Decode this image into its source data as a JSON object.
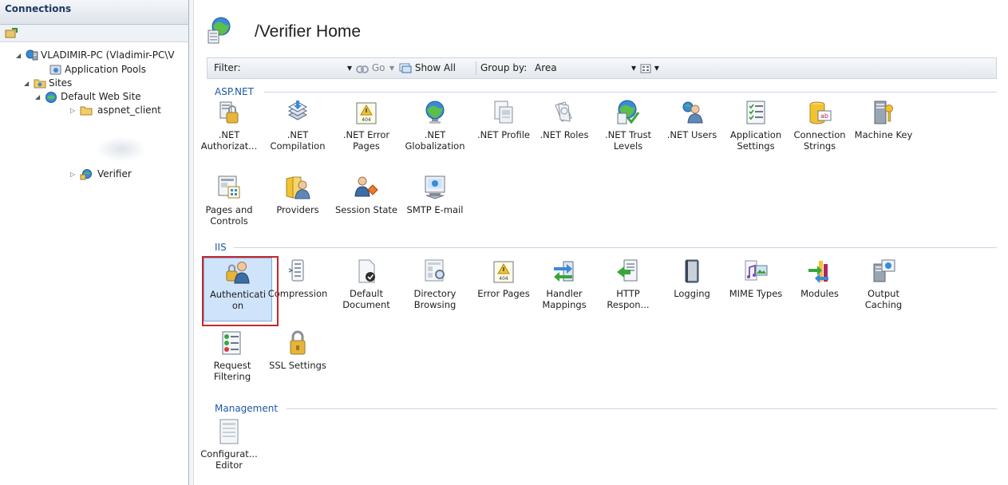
{
  "connections": {
    "header": "Connections",
    "tree": [
      {
        "label": "VLADIMIR-PC (Vladimir-PC\\V",
        "icon": "server-icon"
      },
      {
        "label": "Application Pools",
        "icon": "app-pools-icon"
      },
      {
        "label": "Sites",
        "icon": "sites-folder-icon"
      },
      {
        "label": "Default Web Site",
        "icon": "website-globe-icon"
      },
      {
        "label": "aspnet_client",
        "icon": "folder-icon"
      },
      {
        "label": "Verifier",
        "icon": "web-application-icon"
      }
    ]
  },
  "main": {
    "title": "/Verifier Home",
    "filter_bar": {
      "filter_label": "Filter:",
      "go_label": "Go",
      "show_all_label": "Show All",
      "group_by_label": "Group by:",
      "group_by_value": "Area"
    },
    "groups": [
      {
        "name": "ASP.NET",
        "features": [
          {
            "label": ".NET Authorizat...",
            "icon": "net-authorization-icon"
          },
          {
            "label": ".NET Compilation",
            "icon": "net-compilation-icon"
          },
          {
            "label": ".NET Error Pages",
            "icon": "net-error-pages-icon"
          },
          {
            "label": ".NET Globalization",
            "icon": "net-globalization-icon"
          },
          {
            "label": ".NET Profile",
            "icon": "net-profile-icon"
          },
          {
            "label": ".NET Roles",
            "icon": "net-roles-icon"
          },
          {
            "label": ".NET Trust Levels",
            "icon": "net-trust-levels-icon"
          },
          {
            "label": ".NET Users",
            "icon": "net-users-icon"
          },
          {
            "label": "Application Settings",
            "icon": "application-settings-icon"
          },
          {
            "label": "Connection Strings",
            "icon": "connection-strings-icon"
          },
          {
            "label": "Machine Key",
            "icon": "machine-key-icon"
          },
          {
            "label": "Pages and Controls",
            "icon": "pages-and-controls-icon"
          },
          {
            "label": "Providers",
            "icon": "providers-icon"
          },
          {
            "label": "Session State",
            "icon": "session-state-icon"
          },
          {
            "label": "SMTP E-mail",
            "icon": "smtp-email-icon"
          }
        ]
      },
      {
        "name": "IIS",
        "features": [
          {
            "label": "Authenticati on",
            "icon": "authentication-icon",
            "selected": true
          },
          {
            "label": "Compression",
            "icon": "compression-icon"
          },
          {
            "label": "Default Document",
            "icon": "default-document-icon"
          },
          {
            "label": "Directory Browsing",
            "icon": "directory-browsing-icon"
          },
          {
            "label": "Error Pages",
            "icon": "error-pages-icon"
          },
          {
            "label": "Handler Mappings",
            "icon": "handler-mappings-icon"
          },
          {
            "label": "HTTP Respon...",
            "icon": "http-response-headers-icon"
          },
          {
            "label": "Logging",
            "icon": "logging-icon"
          },
          {
            "label": "MIME Types",
            "icon": "mime-types-icon"
          },
          {
            "label": "Modules",
            "icon": "modules-icon"
          },
          {
            "label": "Output Caching",
            "icon": "output-caching-icon"
          },
          {
            "label": "Request Filtering",
            "icon": "request-filtering-icon"
          },
          {
            "label": "SSL Settings",
            "icon": "ssl-settings-icon"
          }
        ]
      },
      {
        "name": "Management",
        "features": [
          {
            "label": "Configurat... Editor",
            "icon": "configuration-editor-icon"
          }
        ]
      }
    ]
  },
  "colors": {
    "group_header": "#1b5aa6",
    "selection_outline": "#c62828",
    "selected_fill": "#cfe3fa"
  }
}
